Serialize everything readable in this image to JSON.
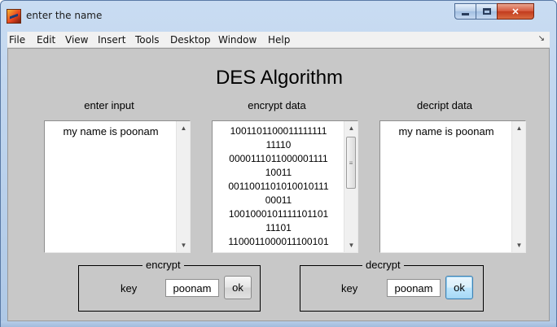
{
  "window": {
    "title": "enter the name",
    "min_label": "",
    "max_label": "",
    "close_label": "✕"
  },
  "menubar": {
    "items": [
      "File",
      "Edit",
      "View",
      "Insert",
      "Tools",
      "Desktop",
      "Window",
      "Help"
    ],
    "overflow_arrow": "↘"
  },
  "main": {
    "title": "DES Algorithm"
  },
  "panels": {
    "input": {
      "label": "enter input",
      "text": "my name is poonam"
    },
    "encrypt": {
      "label": "encrypt data",
      "text": "1001101100011111111\n11110\n0000111011000001111\n10011\n0011001101010010111\n00011\n1001000101111101101\n11101\n1100011000011100101"
    },
    "decrypt": {
      "label": "decript data",
      "text": "my name is poonam"
    }
  },
  "encrypt_group": {
    "label": "encrypt",
    "key_label": "key",
    "key_value": "poonam",
    "ok_label": "ok"
  },
  "decrypt_group": {
    "label": "decrypt",
    "key_label": "key",
    "key_value": "poonam",
    "ok_label": "ok"
  },
  "icons": {
    "scroll_up": "▲",
    "scroll_down": "▼",
    "thumb_grip": "≡"
  },
  "colors": {
    "client_bg": "#c8c8c8",
    "titlebar": "#aec8e6",
    "close_button": "#c23b1e"
  }
}
